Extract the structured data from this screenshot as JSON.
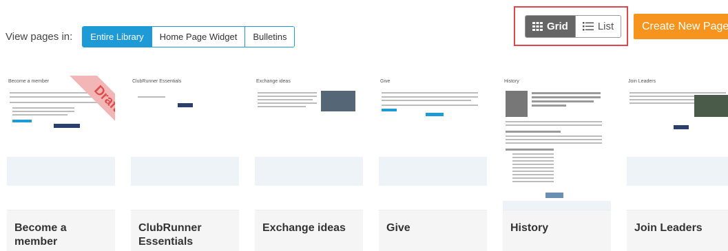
{
  "viewbar": {
    "label": "View pages in:",
    "options": [
      "Entire Library",
      "Home Page Widget",
      "Bulletins"
    ],
    "active": "Entire Library"
  },
  "toggle": {
    "grid_label": "Grid",
    "list_label": "List",
    "active": "Grid"
  },
  "create_button": "Create New Page",
  "cards": [
    {
      "caption": "Become a member",
      "thumb_title": "Become a member",
      "badge": "Draft"
    },
    {
      "caption": "ClubRunner Essentials",
      "thumb_title": "ClubRunner Essentials"
    },
    {
      "caption": "Exchange ideas",
      "thumb_title": "Exchange ideas"
    },
    {
      "caption": "Give",
      "thumb_title": "Give"
    },
    {
      "caption": "History",
      "thumb_title": "History"
    },
    {
      "caption": "Join Leaders",
      "thumb_title": "Join Leaders"
    }
  ],
  "colors": {
    "accent": "#1e9ad6",
    "create": "#f7941d",
    "highlight": "#e0474c"
  }
}
